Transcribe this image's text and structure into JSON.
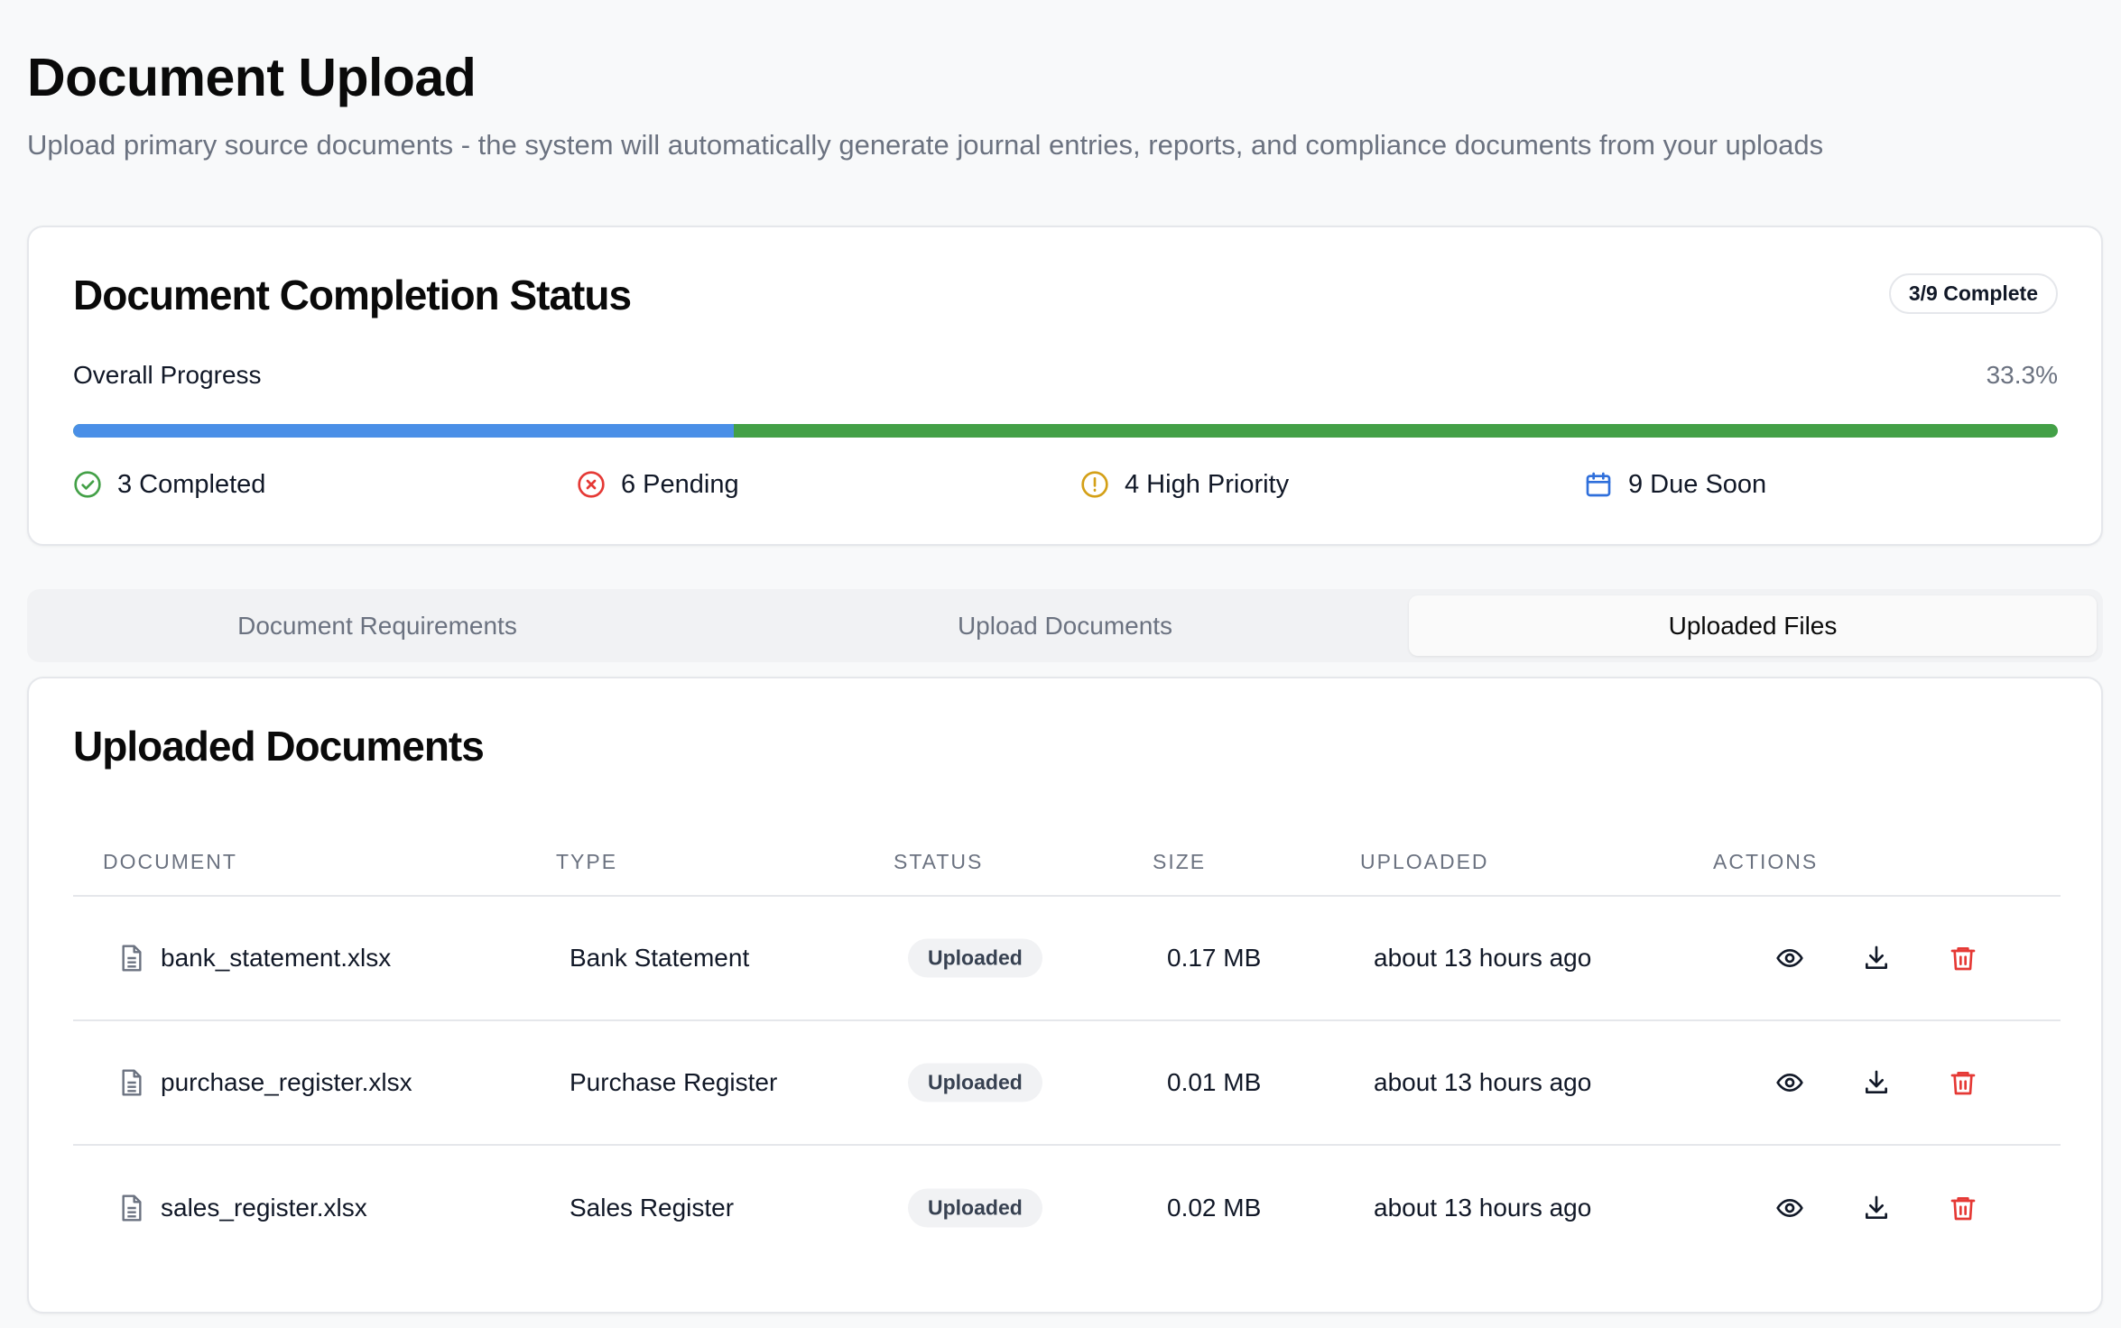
{
  "page": {
    "title": "Document Upload",
    "subtitle": "Upload primary source documents - the system will automatically generate journal entries, reports, and compliance documents from your uploads"
  },
  "status": {
    "title": "Document Completion Status",
    "badge": "3/9 Complete",
    "progress_label": "Overall Progress",
    "progress_value": "33.3%",
    "progress_fraction": 0.333,
    "stats": [
      {
        "label": "3 Completed",
        "icon": "check-circle-icon",
        "color": "#43a047"
      },
      {
        "label": "6 Pending",
        "icon": "x-circle-icon",
        "color": "#e53935"
      },
      {
        "label": "4 High Priority",
        "icon": "alert-circle-icon",
        "color": "#d4a017"
      },
      {
        "label": "9 Due Soon",
        "icon": "calendar-icon",
        "color": "#2f6fdb"
      }
    ]
  },
  "tabs": [
    {
      "label": "Document Requirements",
      "active": false
    },
    {
      "label": "Upload Documents",
      "active": false
    },
    {
      "label": "Uploaded Files",
      "active": true
    }
  ],
  "uploads": {
    "title": "Uploaded Documents",
    "columns": [
      "DOCUMENT",
      "TYPE",
      "STATUS",
      "SIZE",
      "UPLOADED",
      "ACTIONS"
    ],
    "rows": [
      {
        "document": "bank_statement.xlsx",
        "type": "Bank Statement",
        "status": "Uploaded",
        "size": "0.17 MB",
        "uploaded": "about 13 hours ago"
      },
      {
        "document": "purchase_register.xlsx",
        "type": "Purchase Register",
        "status": "Uploaded",
        "size": "0.01 MB",
        "uploaded": "about 13 hours ago"
      },
      {
        "document": "sales_register.xlsx",
        "type": "Sales Register",
        "status": "Uploaded",
        "size": "0.02 MB",
        "uploaded": "about 13 hours ago"
      }
    ]
  },
  "colors": {
    "progress_done": "#4a8fe7",
    "progress_rest": "#43a047",
    "delete": "#e53935"
  }
}
